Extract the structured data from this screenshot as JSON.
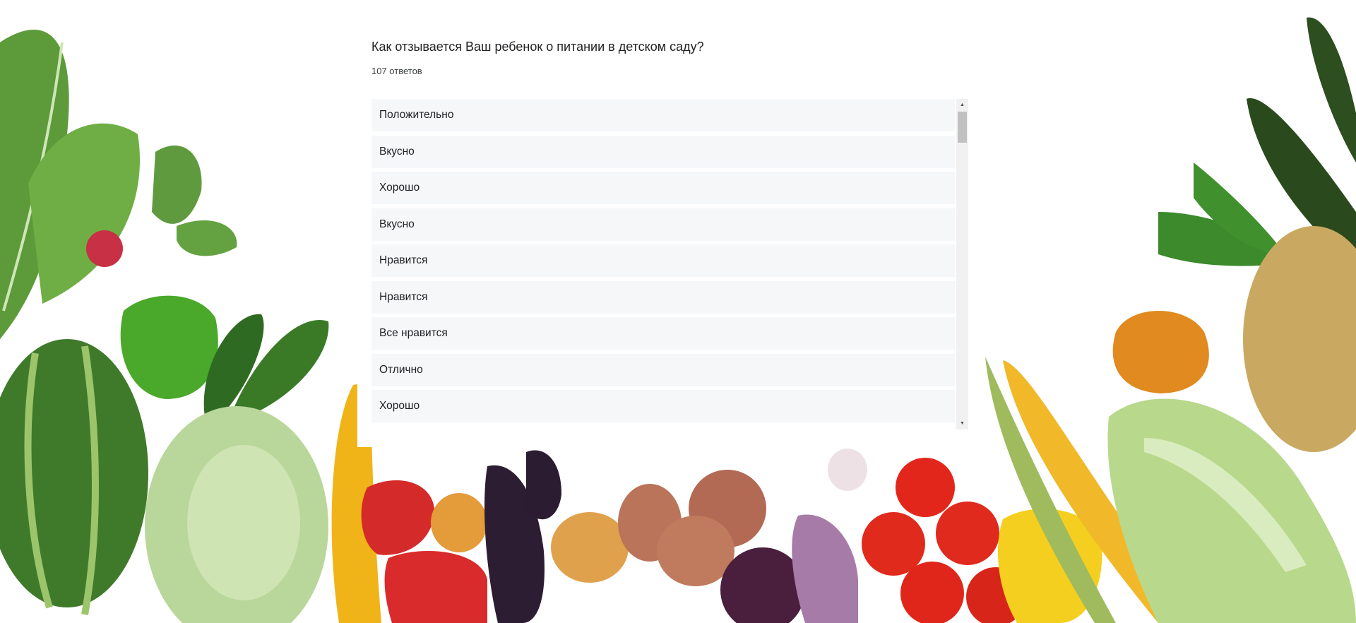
{
  "survey": {
    "question": "Как отзывается Ваш ребенок о питании в детском саду?",
    "answers_count": "107 ответов",
    "responses": [
      "Положительно",
      "Вкусно",
      "Хорошо",
      "Вкусно",
      "Нравится",
      "Нравится",
      "Все нравится",
      "Отлично",
      "Хорошо"
    ]
  },
  "scrollbar": {
    "up_icon": "scroll-up-arrow-icon",
    "down_icon": "scroll-down-arrow-icon"
  },
  "colors": {
    "card_bg": "#ffffff",
    "item_bg": "#f5f7f9",
    "text": "#202124"
  }
}
